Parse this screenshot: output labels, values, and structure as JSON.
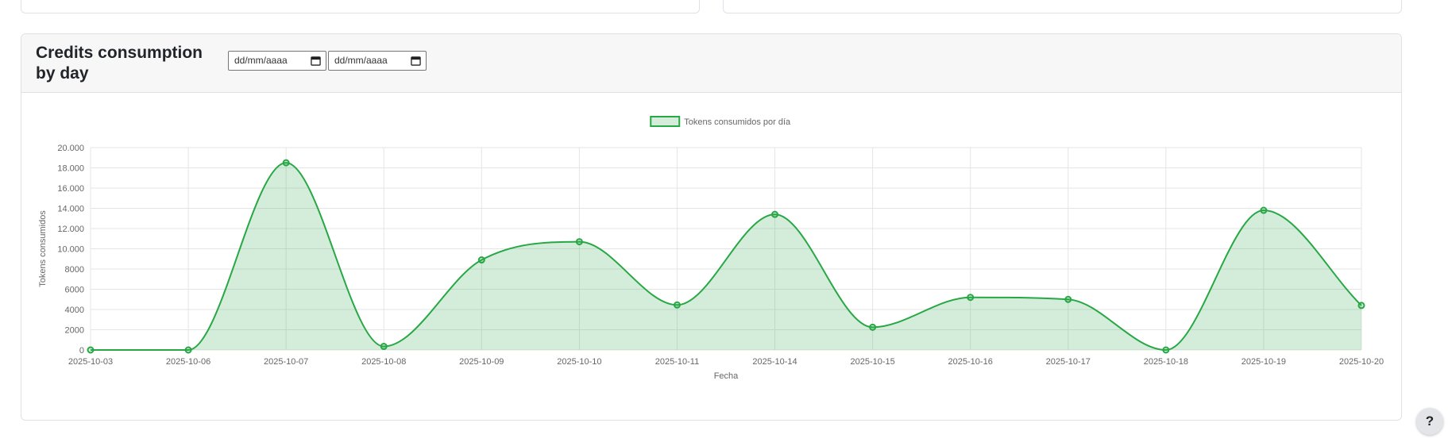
{
  "card": {
    "title": "Credits consumption by day",
    "date_from": {
      "placeholder": "dd/mm/aaaa"
    },
    "date_to": {
      "placeholder": "dd/mm/aaaa"
    }
  },
  "help_button": {
    "label": "?"
  },
  "colors": {
    "line": "#28a745",
    "fill": "rgba(40,167,69,0.2)"
  },
  "chart_data": {
    "type": "area",
    "x": [
      "2025-10-03",
      "2025-10-06",
      "2025-10-07",
      "2025-10-08",
      "2025-10-09",
      "2025-10-10",
      "2025-10-11",
      "2025-10-14",
      "2025-10-15",
      "2025-10-16",
      "2025-10-17",
      "2025-10-18",
      "2025-10-19",
      "2025-10-20"
    ],
    "series": [
      {
        "name": "Tokens consumidos por día",
        "values": [
          0,
          0,
          18500,
          350,
          8900,
          10700,
          4450,
          13400,
          2250,
          5200,
          5000,
          0,
          13800,
          4400
        ]
      }
    ],
    "xlabel": "Fecha",
    "ylabel": "Tokens consumidos",
    "ylim": [
      0,
      20000
    ],
    "yticks": [
      "0",
      "2000",
      "4000",
      "6000",
      "8000",
      "10.000",
      "12.000",
      "14.000",
      "16.000",
      "18.000",
      "20.000"
    ],
    "grid": true,
    "legend": "top-center"
  }
}
